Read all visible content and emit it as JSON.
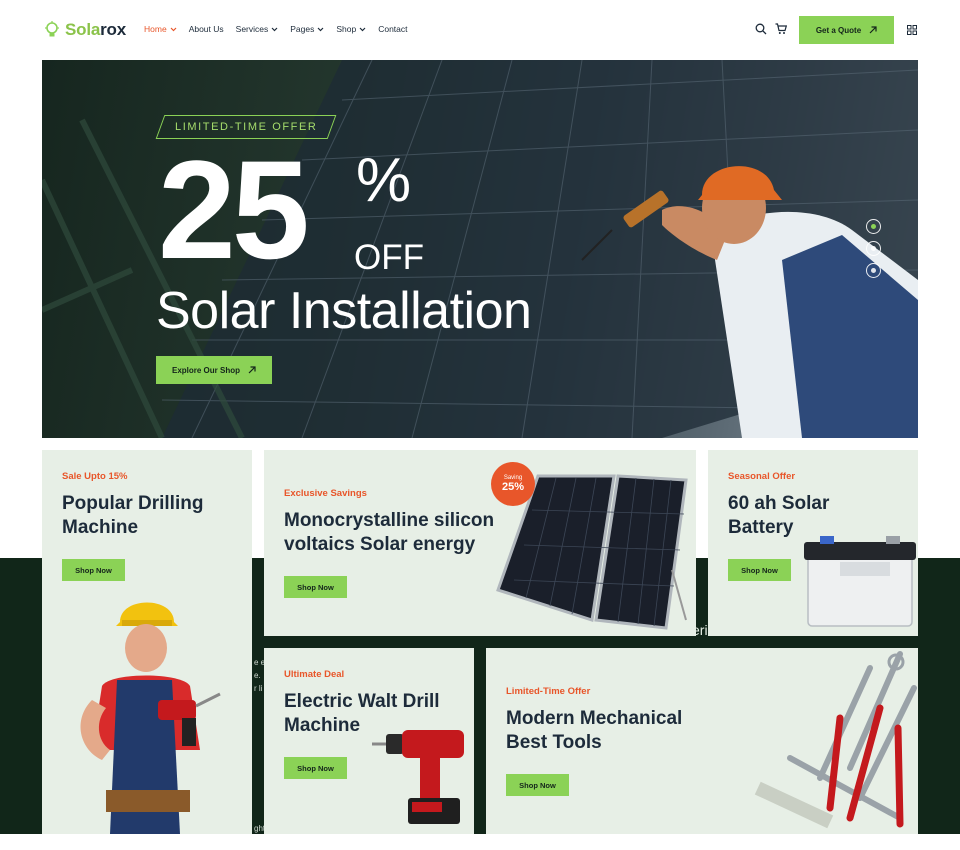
{
  "header": {
    "logo": {
      "part1": "Sola",
      "part2": "rox"
    },
    "nav": [
      {
        "label": "Home",
        "active": true,
        "dropdown": true
      },
      {
        "label": "About Us",
        "active": false,
        "dropdown": false
      },
      {
        "label": "Services",
        "active": false,
        "dropdown": true
      },
      {
        "label": "Pages",
        "active": false,
        "dropdown": true
      },
      {
        "label": "Shop",
        "active": false,
        "dropdown": true
      },
      {
        "label": "Contact",
        "active": false,
        "dropdown": false
      }
    ],
    "icons": [
      "search-icon",
      "cart-icon",
      "grid-menu-icon"
    ],
    "quote_button": "Get a Quote"
  },
  "hero": {
    "tag": "LIMITED-TIME OFFER",
    "number": "25",
    "percent": "%",
    "off": "OFF",
    "title": "Solar Installation",
    "button": "Explore Our Shop",
    "slides": 3,
    "active_slide": 1
  },
  "cards": {
    "drill": {
      "kicker": "Sale Upto 15%",
      "title_line1": "Popular Drilling",
      "title_line2": "Machine",
      "button": "Shop Now"
    },
    "solar": {
      "kicker": "Exclusive Savings",
      "title_line1": "Monocrystalline silicon",
      "title_line2": "voltaics Solar energy",
      "button": "Shop Now",
      "badge_small": "Saving",
      "badge_big": "25%"
    },
    "battery": {
      "kicker": "Seasonal Offer",
      "title_line1": "60 ah Solar",
      "title_line2": "Battery",
      "button": "Shop Now"
    },
    "walt": {
      "kicker": "Ultimate Deal",
      "title_line1": "Electric Walt Drill",
      "title_line2": "Machine",
      "button": "Shop Now"
    },
    "tools": {
      "kicker": "Limited-Time Offer",
      "title_line1": "Modern Mechanical",
      "title_line2": "Best Tools",
      "button": "Shop Now"
    }
  },
  "band_fragments": [
    "eri",
    "e e",
    "e.",
    "r li",
    "ght"
  ],
  "colors": {
    "accent": "#8bd256",
    "orange": "#e8562a",
    "dark": "#112619",
    "card": "#e7efe6",
    "text": "#1d2b3a"
  }
}
